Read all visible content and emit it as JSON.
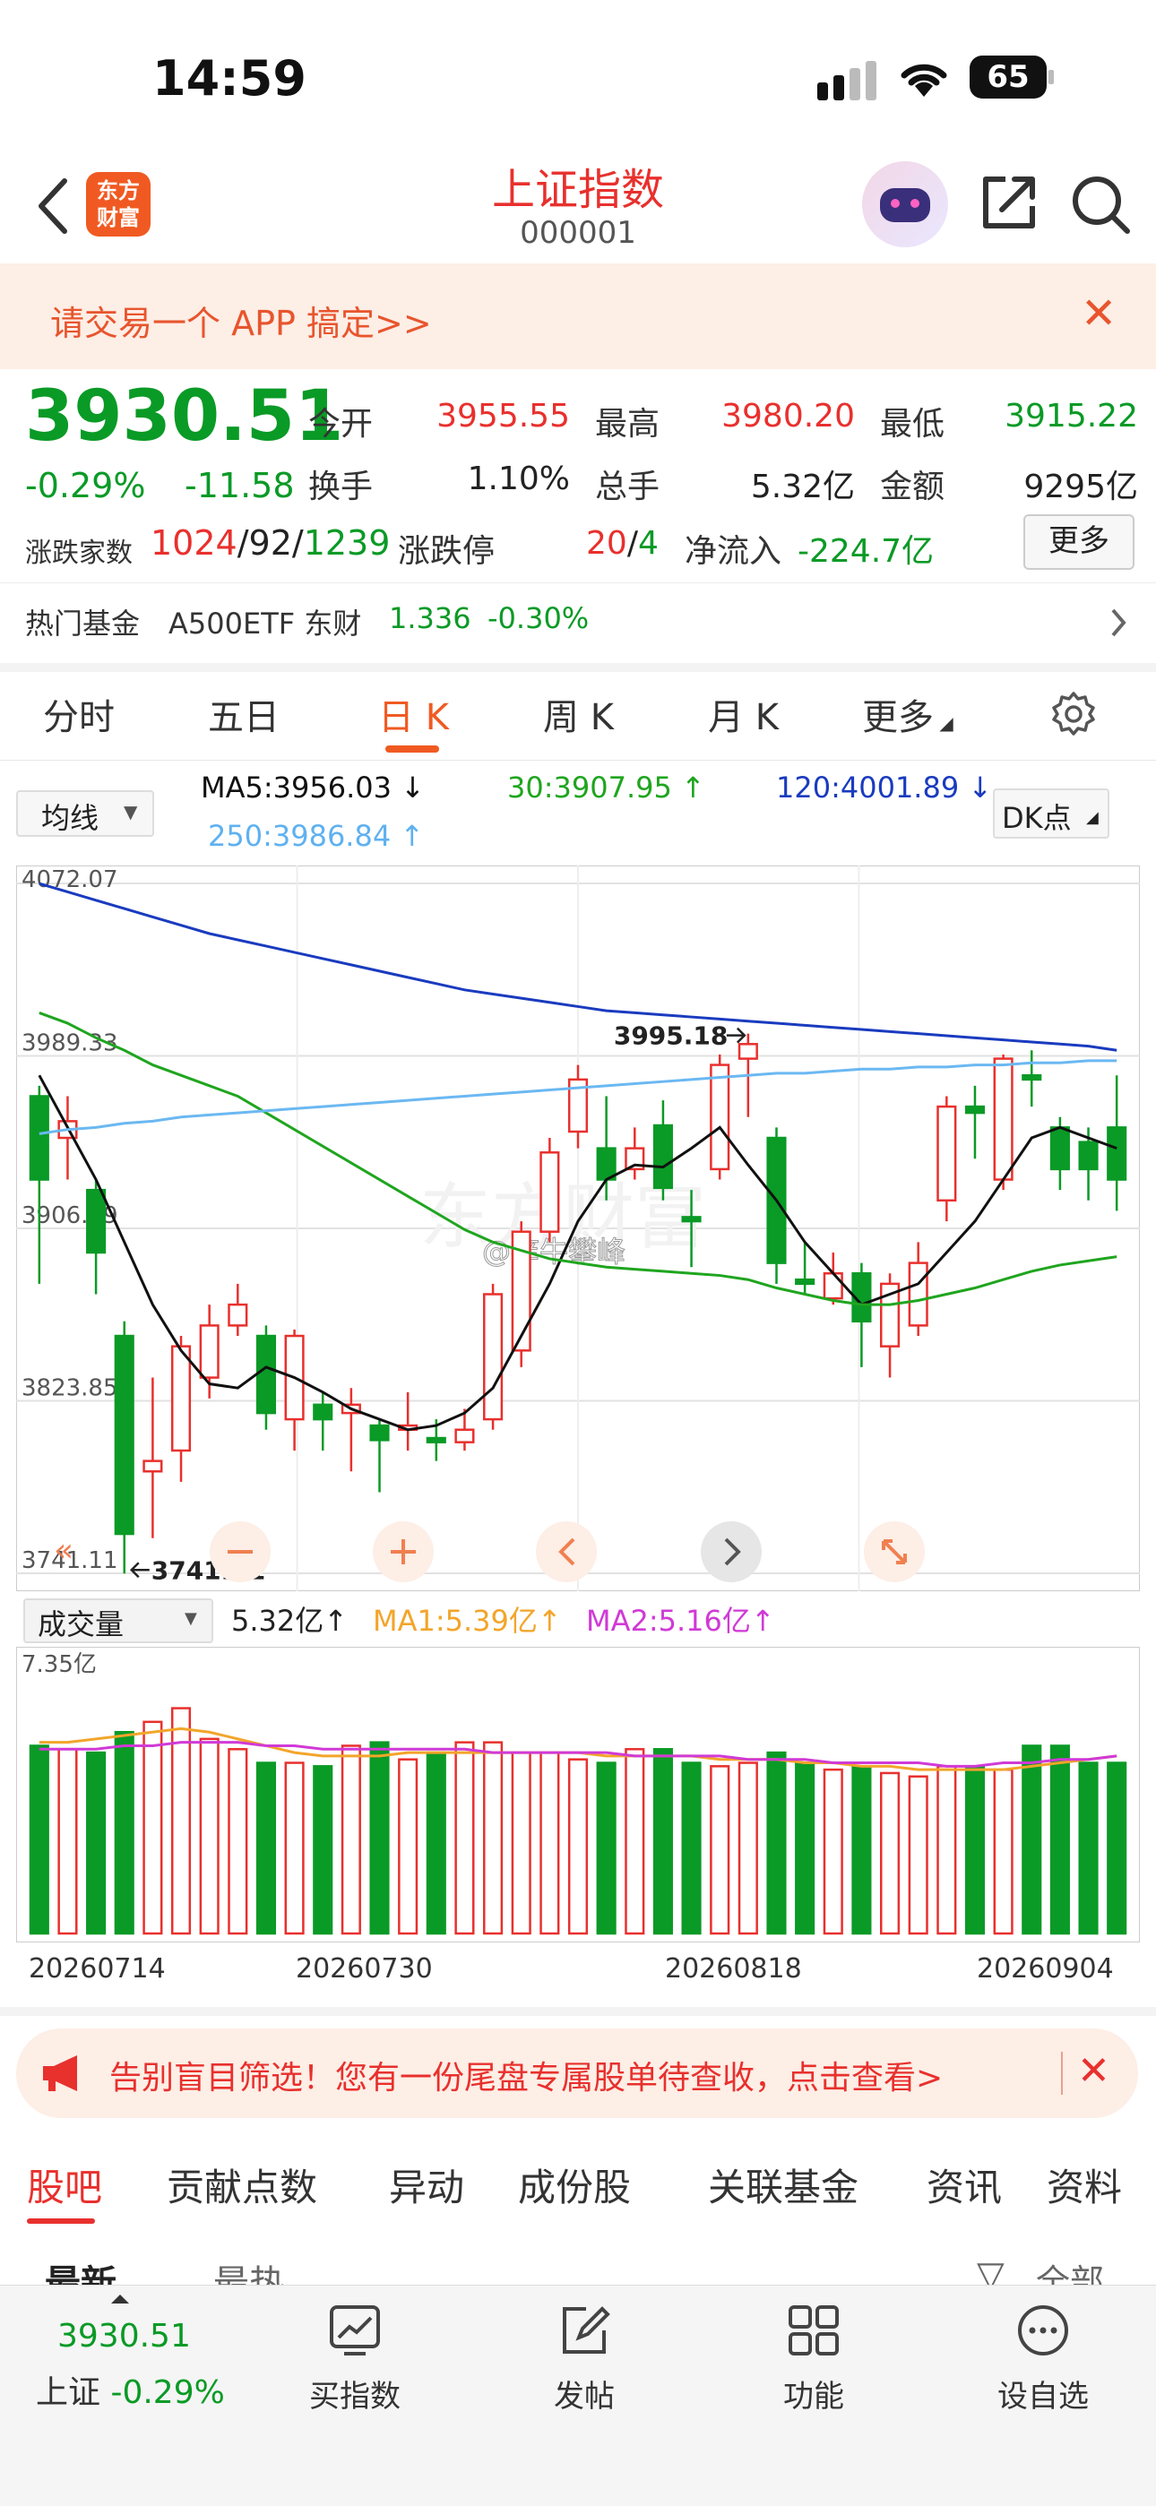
{
  "status_bar": {
    "time": "14:59",
    "battery": "65"
  },
  "header": {
    "logo_line1": "东方",
    "logo_line2": "财富",
    "title": "上证指数",
    "code": "000001"
  },
  "promo": {
    "text": "请交易一个 APP 搞定>>"
  },
  "quote": {
    "price": "3930.51",
    "change_pct": "-0.29%",
    "change_amt": "-11.58",
    "open_label": "今开",
    "open": "3955.55",
    "high_label": "最高",
    "high": "3980.20",
    "low_label": "最低",
    "low": "3915.22",
    "turnover_label": "换手",
    "turnover": "1.10%",
    "volume_label": "总手",
    "volume": "5.32亿",
    "amount_label": "金额",
    "amount": "9295亿",
    "updown_label": "涨跌家数",
    "up": "1024",
    "flat": "92",
    "down": "1239",
    "limit_label": "涨跌停",
    "limit_up": "20",
    "limit_down": "4",
    "netflow_label": "净流入",
    "netflow": "-224.7亿",
    "more": "更多",
    "sep": "/"
  },
  "hot_fund": {
    "label": "热门基金",
    "name": "A500ETF 东财",
    "price": "1.336",
    "change": "-0.30%"
  },
  "kline_tabs": [
    "分时",
    "五日",
    "日 K",
    "周 K",
    "月 K",
    "更多"
  ],
  "ma": {
    "select": "均线",
    "ma5": "MA5:3956.03 ↓",
    "ma30": "30:3907.95 ↑",
    "ma120": "120:4001.89 ↓",
    "ma250": "250:3986.84 ↑",
    "dk": "DK点"
  },
  "colors": {
    "up": "#e8302d",
    "down": "#0a9a26",
    "ma5": "#111111",
    "ma30": "#1fa51f",
    "ma120": "#1a3bbf",
    "ma250": "#6bb8f2",
    "accent": "#f05a22"
  },
  "chart_data": [
    {
      "type": "candlestick",
      "title": "",
      "y_ticks": [
        "4072.07",
        "3989.33",
        "3906.59",
        "3823.85",
        "3741.11"
      ],
      "ylim": [
        3741.11,
        4072.07
      ],
      "annotations": {
        "max_label": "3995.18",
        "min_label": "3741.11"
      },
      "series": [
        {
          "name": "K",
          "ohlc": [
            [
              3970,
              3930,
              3975,
              3880
            ],
            [
              3950,
              3958,
              3970,
              3930
            ],
            [
              3925,
              3895,
              3930,
              3875
            ],
            [
              3855,
              3760,
              3862,
              3741
            ],
            [
              3790,
              3795,
              3835,
              3758
            ],
            [
              3800,
              3850,
              3855,
              3785
            ],
            [
              3835,
              3860,
              3870,
              3825
            ],
            [
              3860,
              3870,
              3880,
              3855
            ],
            [
              3855,
              3818,
              3860,
              3810
            ],
            [
              3815,
              3855,
              3858,
              3800
            ],
            [
              3822,
              3815,
              3828,
              3800
            ],
            [
              3818,
              3822,
              3830,
              3790
            ],
            [
              3812,
              3805,
              3815,
              3780
            ],
            [
              3810,
              3812,
              3828,
              3800
            ],
            [
              3806,
              3804,
              3815,
              3795
            ],
            [
              3804,
              3810,
              3820,
              3800
            ],
            [
              3815,
              3875,
              3880,
              3810
            ],
            [
              3848,
              3905,
              3910,
              3840
            ],
            [
              3905,
              3943,
              3950,
              3900
            ],
            [
              3953,
              3978,
              3985,
              3945
            ],
            [
              3945,
              3930,
              3970,
              3920
            ],
            [
              3935,
              3945,
              3955,
              3930
            ],
            [
              3956,
              3926,
              3968,
              3920
            ],
            [
              3912,
              3910,
              3925,
              3888
            ],
            [
              3935,
              3985,
              3990,
              3930
            ],
            [
              3988,
              3995,
              4000,
              3960
            ],
            [
              3950,
              3890,
              3955,
              3880
            ],
            [
              3882,
              3880,
              3900,
              3875
            ],
            [
              3873,
              3885,
              3895,
              3870
            ],
            [
              3885,
              3862,
              3890,
              3840
            ],
            [
              3850,
              3880,
              3885,
              3835
            ],
            [
              3860,
              3890,
              3900,
              3855
            ],
            [
              3920,
              3965,
              3970,
              3910
            ],
            [
              3965,
              3962,
              3975,
              3940
            ],
            [
              3930,
              3988,
              3990,
              3925
            ],
            [
              3980,
              3978,
              3992,
              3965
            ],
            [
              3955,
              3935,
              3960,
              3925
            ],
            [
              3948,
              3935,
              3955,
              3920
            ],
            [
              3955,
              3930,
              3980,
              3915
            ]
          ]
        },
        {
          "name": "MA5",
          "values": [
            3980,
            3955,
            3930,
            3900,
            3870,
            3848,
            3832,
            3830,
            3840,
            3835,
            3828,
            3820,
            3815,
            3810,
            3812,
            3818,
            3830,
            3855,
            3880,
            3910,
            3930,
            3937,
            3936,
            3945,
            3955,
            3937,
            3920,
            3900,
            3885,
            3870,
            3875,
            3880,
            3895,
            3910,
            3930,
            3950,
            3955,
            3950,
            3945
          ]
        },
        {
          "name": "MA30",
          "values": [
            4010,
            4005,
            3998,
            3992,
            3985,
            3980,
            3975,
            3970,
            3962,
            3954,
            3946,
            3938,
            3930,
            3922,
            3914,
            3906,
            3900,
            3896,
            3892,
            3890,
            3888,
            3887,
            3886,
            3885,
            3884,
            3882,
            3878,
            3875,
            3872,
            3870,
            3870,
            3872,
            3875,
            3878,
            3882,
            3886,
            3889,
            3891,
            3893
          ]
        },
        {
          "name": "MA120",
          "values": [
            4072,
            4068,
            4064,
            4060,
            4056,
            4052,
            4048,
            4045,
            4042,
            4039,
            4036,
            4033,
            4030,
            4027,
            4024,
            4021,
            4019,
            4017,
            4015,
            4013,
            4011,
            4010,
            4009,
            4008,
            4007,
            4006,
            4005,
            4004,
            4003,
            4002,
            4001,
            4000,
            3999,
            3998,
            3997,
            3996,
            3995,
            3994,
            3992
          ]
        },
        {
          "name": "MA250",
          "values": [
            3952,
            3954,
            3955,
            3957,
            3958,
            3960,
            3961,
            3962,
            3963,
            3964,
            3965,
            3966,
            3967,
            3968,
            3969,
            3970,
            3971,
            3972,
            3973,
            3974,
            3975,
            3976,
            3977,
            3978,
            3979,
            3980,
            3981,
            3981,
            3982,
            3983,
            3983,
            3984,
            3984,
            3985,
            3985,
            3986,
            3986,
            3987,
            3987
          ]
        }
      ]
    },
    {
      "type": "bar",
      "title": "",
      "y_ticks": [
        "7.35亿"
      ],
      "ylim": [
        0,
        7.35
      ],
      "labels": {
        "select": "成交量",
        "vol": "5.32亿↑",
        "ma1": "MA1:5.39亿↑",
        "ma2": "MA2:5.16亿↑"
      },
      "categories": [
        "20260714",
        "20260730",
        "20260818",
        "20260904"
      ],
      "series": [
        {
          "name": "VOL",
          "values": [
            5.5,
            5.4,
            5.3,
            5.9,
            6.2,
            6.6,
            5.7,
            5.4,
            5.0,
            5.0,
            4.9,
            5.5,
            5.6,
            5.1,
            5.3,
            5.6,
            5.6,
            5.3,
            5.3,
            5.1,
            5.0,
            5.4,
            5.4,
            5.0,
            4.9,
            5.0,
            5.3,
            5.0,
            4.8,
            4.9,
            4.7,
            4.6,
            4.9,
            4.9,
            4.8,
            5.5,
            5.5,
            5.0,
            5.0
          ]
        },
        {
          "name": "MA1",
          "values": [
            5.6,
            5.6,
            5.7,
            5.8,
            5.9,
            6.0,
            5.9,
            5.7,
            5.5,
            5.3,
            5.2,
            5.2,
            5.2,
            5.3,
            5.3,
            5.3,
            5.3,
            5.3,
            5.3,
            5.3,
            5.2,
            5.2,
            5.2,
            5.2,
            5.1,
            5.1,
            5.1,
            5.0,
            5.0,
            4.9,
            4.9,
            4.8,
            4.8,
            4.8,
            4.8,
            4.9,
            5.0,
            5.1,
            5.2
          ]
        },
        {
          "name": "MA2",
          "values": [
            5.4,
            5.4,
            5.4,
            5.5,
            5.5,
            5.6,
            5.6,
            5.6,
            5.5,
            5.5,
            5.4,
            5.4,
            5.4,
            5.4,
            5.4,
            5.4,
            5.3,
            5.3,
            5.3,
            5.3,
            5.3,
            5.2,
            5.2,
            5.2,
            5.2,
            5.1,
            5.1,
            5.1,
            5.0,
            5.0,
            5.0,
            5.0,
            4.9,
            4.9,
            5.0,
            5.0,
            5.1,
            5.1,
            5.2
          ]
        }
      ]
    }
  ],
  "ad": {
    "text": "告别盲目筛选！您有一份尾盘专属股单待查收，点击查看>"
  },
  "bottom_tabs": [
    "股吧",
    "贡献点数",
    "异动",
    "成份股",
    "关联基金",
    "资讯",
    "资料"
  ],
  "sub_tabs": {
    "latest": "最新",
    "hot": "最热",
    "all": "全部"
  },
  "footer": {
    "price": "3930.51",
    "index_label": "上证",
    "index_change": "-0.29%",
    "buy": "买指数",
    "post": "发帖",
    "func": "功能",
    "watch": "设自选"
  },
  "watermark": "@痒牛攀峰"
}
